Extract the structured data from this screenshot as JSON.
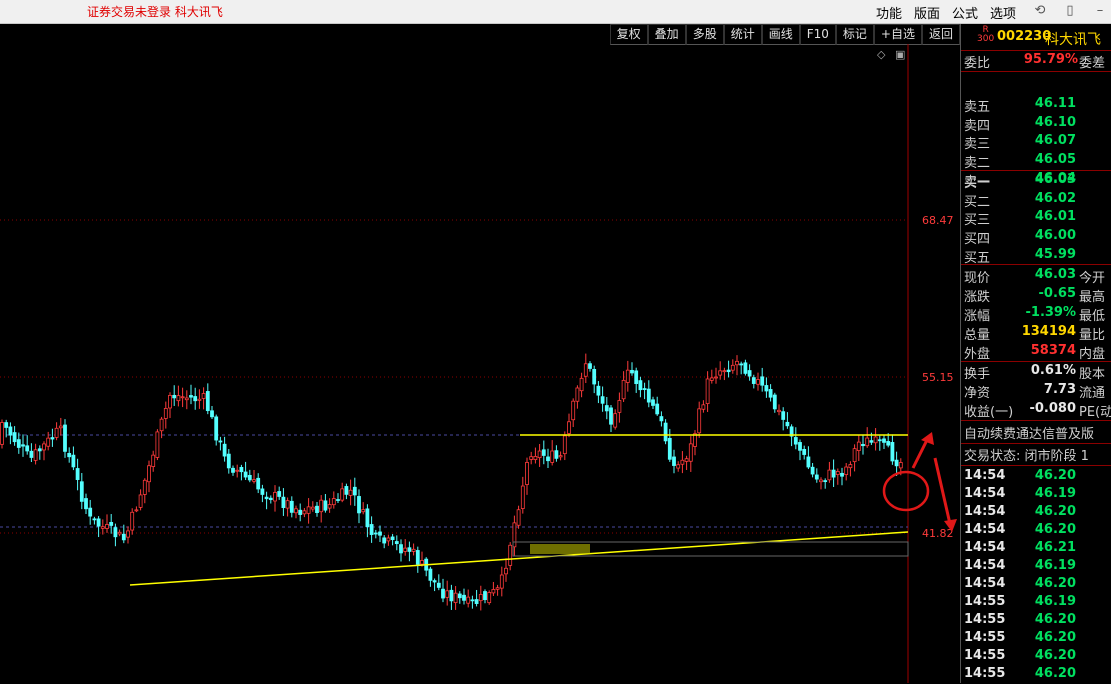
{
  "topbar": {
    "notice": "证券交易未登录  科大讯飞",
    "menus": [
      "功能",
      "版面",
      "公式",
      "选项"
    ],
    "icons": [
      "refresh-icon",
      "window-icon",
      "minimize-icon"
    ]
  },
  "toolbar": [
    "复权",
    "叠加",
    "多股",
    "统计",
    "画线",
    "F10",
    "标记",
    "+自选",
    "返回"
  ],
  "chart": {
    "price_labels": [
      "68.47",
      "55.15",
      "41.82"
    ],
    "colors": {
      "up": "#ff3b3b",
      "down": "#54ffff",
      "trendline": "#ffff00",
      "annotation": "#e01818"
    }
  },
  "quote": {
    "badge_r": "R",
    "badge_num": "300",
    "code": "002230",
    "name": "科大讯飞",
    "weibi_label": "委比",
    "weibi_value": "95.79%",
    "weicha_label": "委差",
    "sell": [
      {
        "label": "卖五",
        "price": "46.11"
      },
      {
        "label": "卖四",
        "price": "46.10"
      },
      {
        "label": "卖三",
        "price": "46.07"
      },
      {
        "label": "卖二",
        "price": "46.05"
      },
      {
        "label": "卖一",
        "price": "46.04"
      }
    ],
    "buy": [
      {
        "label": "买一",
        "price": "46.03"
      },
      {
        "label": "买二",
        "price": "46.02"
      },
      {
        "label": "买三",
        "price": "46.01"
      },
      {
        "label": "买四",
        "price": "46.00"
      },
      {
        "label": "买五",
        "price": "45.99"
      }
    ],
    "stats": [
      {
        "label": "现价",
        "value": "46.03",
        "color": "green",
        "ext": "今开"
      },
      {
        "label": "涨跌",
        "value": "-0.65",
        "color": "green",
        "ext": "最高"
      },
      {
        "label": "涨幅",
        "value": "-1.39%",
        "color": "green",
        "ext": "最低"
      },
      {
        "label": "总量",
        "value": "134194",
        "color": "yellow",
        "ext": "量比"
      },
      {
        "label": "外盘",
        "value": "58374",
        "color": "red",
        "ext": "内盘"
      }
    ],
    "stats2": [
      {
        "label": "换手",
        "value": "0.61%",
        "ext": "股本"
      },
      {
        "label": "净资",
        "value": "7.73",
        "ext": "流通"
      },
      {
        "label": "收益(一)",
        "value": "-0.080",
        "ext": "PE(动"
      }
    ],
    "banner": "自动续费通达信普及版",
    "status": "交易状态: 闭市阶段 1",
    "ticks": [
      {
        "time": "14:54",
        "price": "46.20"
      },
      {
        "time": "14:54",
        "price": "46.19"
      },
      {
        "time": "14:54",
        "price": "46.20"
      },
      {
        "time": "14:54",
        "price": "46.20"
      },
      {
        "time": "14:54",
        "price": "46.21"
      },
      {
        "time": "14:54",
        "price": "46.19"
      },
      {
        "time": "14:54",
        "price": "46.20"
      },
      {
        "time": "14:55",
        "price": "46.19"
      },
      {
        "time": "14:55",
        "price": "46.20"
      },
      {
        "time": "14:55",
        "price": "46.20"
      },
      {
        "time": "14:55",
        "price": "46.20"
      },
      {
        "time": "14:55",
        "price": "46.20"
      }
    ]
  }
}
